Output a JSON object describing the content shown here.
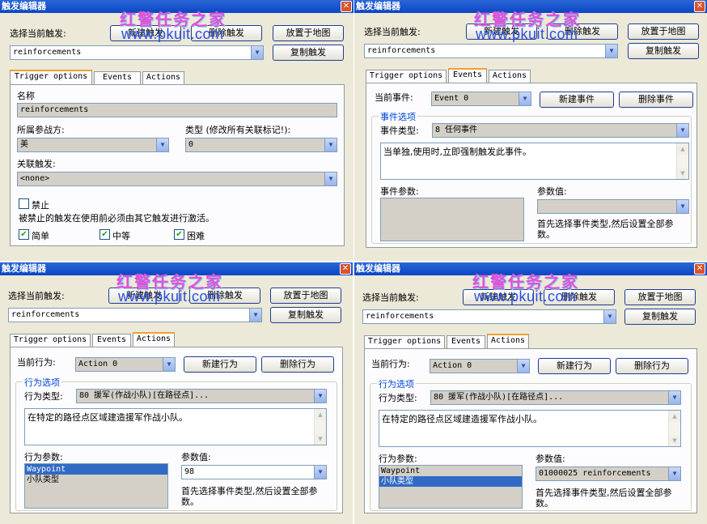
{
  "title": "触发编辑器",
  "close_glyph": "✕",
  "arrow_glyph": "▼",
  "watermark": {
    "text": "红警任务之家",
    "url": "www.pkuit.com"
  },
  "common": {
    "select_trigger_label": "选择当前触发:",
    "new_trigger": "新建触发",
    "delete_trigger": "删除触发",
    "place_on_map": "放置于地图",
    "copy_trigger": "复制触发",
    "trigger_value": "reinforcements",
    "tabs": [
      "Trigger options",
      "Events",
      "Actions"
    ]
  },
  "panel_tl": {
    "name_label": "名称",
    "name_value": "reinforcements",
    "house_label": "所属参战方:",
    "house_value": "美",
    "type_label": "类型 (修改所有关联标记!):",
    "type_value": "0",
    "attached_label": "关联触发:",
    "attached_value": "<none>",
    "disabled_label": "禁止",
    "disabled_note": "被禁止的触发在使用前必须由其它触发进行激活。",
    "easy": "简单",
    "medium": "中等",
    "hard": "困难"
  },
  "panel_tr": {
    "current_event_label": "当前事件:",
    "event_value": "Event 0",
    "new_event": "新建事件",
    "delete_event": "删除事件",
    "group_title": "事件选项",
    "event_type_label": "事件类型:",
    "event_type_value": "8 任何事件",
    "description": "当单独,使用时,立即强制触发此事件。",
    "params_label": "事件参数:",
    "param_value_label": "参数值:",
    "hint": "首先选择事件类型,然后设置全部参数。"
  },
  "panel_bl": {
    "current_action_label": "当前行为:",
    "action_value": "Action 0",
    "new_action": "新建行为",
    "delete_action": "删除行为",
    "group_title": "行为选项",
    "action_type_label": "行为类型:",
    "action_type_value": "80 援军(作战小队)[在路径点]...",
    "description": "在特定的路径点区域建造援军作战小队。",
    "params_label": "行为参数:",
    "params": [
      "Waypoint",
      "小队类型"
    ],
    "param_value_label": "参数值:",
    "param_value": "98",
    "hint": "首先选择事件类型,然后设置全部参数。"
  },
  "panel_br": {
    "current_action_label": "当前行为:",
    "action_value": "Action 0",
    "new_action": "新建行为",
    "delete_action": "删除行为",
    "group_title": "行为选项",
    "action_type_label": "行为类型:",
    "action_type_value": "80 援军(作战小队)[在路径点]...",
    "description": "在特定的路径点区域建造援军作战小队。",
    "params_label": "行为参数:",
    "params": [
      "Waypoint",
      "小队类型"
    ],
    "param_value_label": "参数值:",
    "param_value": "01000025 reinforcements",
    "hint": "首先选择事件类型,然后设置全部参数。"
  }
}
